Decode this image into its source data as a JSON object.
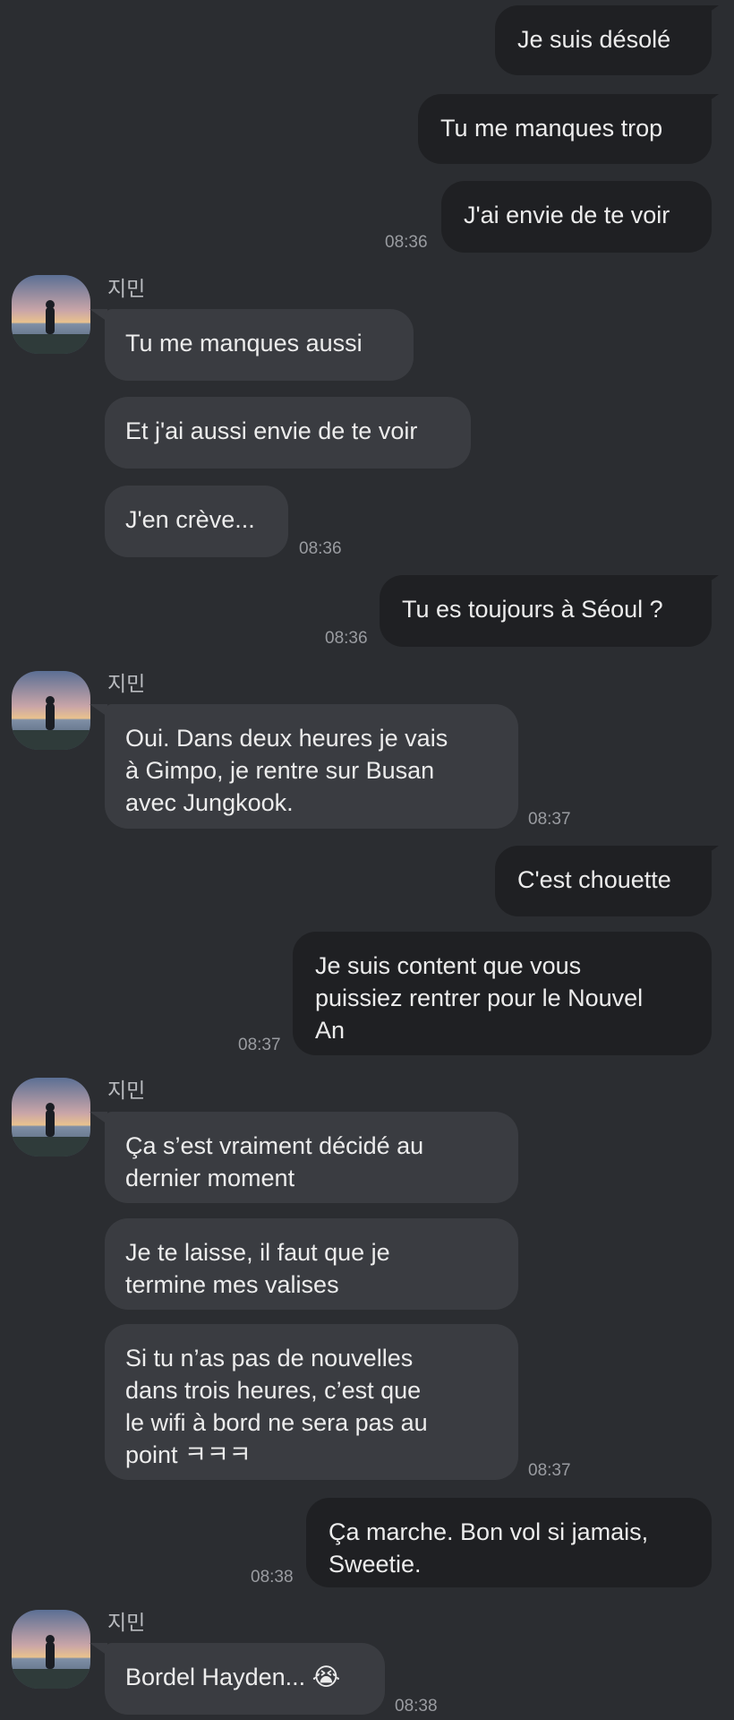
{
  "contact": {
    "name": "지민"
  },
  "messages": [
    {
      "dir": "out",
      "text": "Je suis désolé"
    },
    {
      "dir": "out",
      "text": "Tu me manques trop"
    },
    {
      "dir": "out",
      "text": "J'ai envie de te voir",
      "time": "08:36"
    },
    {
      "dir": "in",
      "text": "Tu me manques aussi"
    },
    {
      "dir": "in",
      "text": "Et j'ai aussi envie de te voir"
    },
    {
      "dir": "in",
      "text": "J'en crève...",
      "time": "08:36"
    },
    {
      "dir": "out",
      "text": "Tu es toujours à Séoul ?",
      "time": "08:36"
    },
    {
      "dir": "in",
      "text": "Oui. Dans deux heures je vais\nà Gimpo, je rentre sur Busan\navec Jungkook.",
      "time": "08:37"
    },
    {
      "dir": "out",
      "text": "C'est chouette"
    },
    {
      "dir": "out",
      "text": "Je suis content que vous\npuissiez rentrer pour le Nouvel\nAn",
      "time": "08:37"
    },
    {
      "dir": "in",
      "text": "Ça s’est vraiment décidé au\ndernier moment"
    },
    {
      "dir": "in",
      "text": "Je te laisse, il faut que je\ntermine mes valises"
    },
    {
      "dir": "in",
      "text": "Si tu n’as pas de nouvelles\ndans trois heures, c’est que\nle wifi à bord ne sera pas au\npoint ㅋㅋㅋ",
      "time": "08:37"
    },
    {
      "dir": "out",
      "text": "Ça marche. Bon vol si jamais,\nSweetie.",
      "time": "08:38"
    },
    {
      "dir": "in",
      "text": "Bordel Hayden... 😭",
      "time": "08:38"
    }
  ]
}
